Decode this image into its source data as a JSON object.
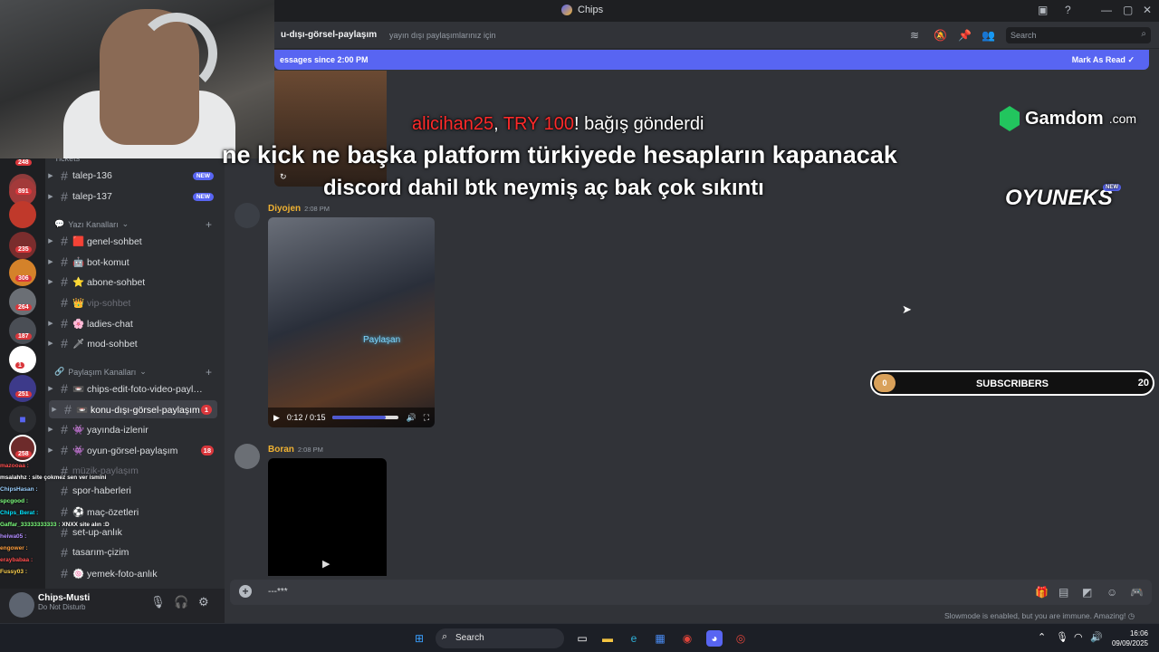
{
  "window": {
    "title": "Chips"
  },
  "header": {
    "channel_name": "konu-dışı-görsel-paylaşım",
    "channel_name_visible": "u-dışı-görsel-paylaşım",
    "topic": "yayın dışı paylaşımlarınız için",
    "search_placeholder": "Search"
  },
  "new_messages_bar": {
    "text": "essages since 2:00 PM",
    "mark_read": "Mark As Read"
  },
  "servers": [
    {
      "badge": "248"
    },
    {
      "badge": "891"
    },
    {
      "badge": ""
    },
    {
      "badge": "235"
    },
    {
      "badge": "306"
    },
    {
      "badge": "264"
    },
    {
      "badge": "187"
    },
    {
      "badge": "1"
    },
    {
      "badge": "251"
    },
    {
      "badge": ""
    },
    {
      "badge": "258"
    }
  ],
  "sidebar": {
    "categories": [
      {
        "label": "Tickets"
      },
      {
        "label": "Yazı Kanalları"
      },
      {
        "label": "Paylaşım Kanalları"
      }
    ],
    "channels": [
      {
        "label": "talep-136",
        "badge": "NEW"
      },
      {
        "label": "talep-137",
        "badge": "NEW"
      },
      {
        "label": "🟥 genel-sohbet"
      },
      {
        "label": "🤖 bot-komut"
      },
      {
        "label": "⭐ abone-sohbet"
      },
      {
        "label": "👑 vip-sohbet"
      },
      {
        "label": "🌸 ladies-chat"
      },
      {
        "label": "🗡 mod-sohbet"
      },
      {
        "label": "📼 chips-edit-foto-video-payla..."
      },
      {
        "label": "📼 konu-dışı-görsel-paylaşım",
        "badge": "1"
      },
      {
        "label": "👾 yayında-izlenir"
      },
      {
        "label": "👾 oyun-görsel-paylaşım",
        "badge": "18"
      },
      {
        "label": "müzik-paylaşım"
      },
      {
        "label": "spor-haberleri"
      },
      {
        "label": "⚽ maç-özetleri"
      },
      {
        "label": "set-up-anlık"
      },
      {
        "label": "tasarım-çizim"
      },
      {
        "label": "🍥 yemek-foto-anlık"
      }
    ]
  },
  "user": {
    "name": "Chips-Musti",
    "status": "Do Not Disturb"
  },
  "chat_overlay": [
    {
      "user": "mazooaa",
      "text": "",
      "color": "#ff4d4d"
    },
    {
      "user": "msalahhz",
      "text": "site çokmez sen ver ismini",
      "color": "#ffffff"
    },
    {
      "user": "ChipsHasan",
      "text": "",
      "color": "#9ad0ff"
    },
    {
      "user": "spcgood",
      "text": "",
      "color": "#7cff7c"
    },
    {
      "user": "Chips_Berat",
      "text": "",
      "color": "#00e5ff"
    },
    {
      "user": "Gaffar_33333333333",
      "text": "XNXX site alın :D",
      "color": "#7cff7c"
    },
    {
      "user": "heiwa05",
      "text": "",
      "color": "#b28cff"
    },
    {
      "user": "engower",
      "text": "",
      "color": "#ff9e3d"
    },
    {
      "user": "eraybabaa",
      "text": "",
      "color": "#ff4d4d"
    },
    {
      "user": "Fussy03",
      "text": "",
      "color": "#ffd24d"
    }
  ],
  "messages": [
    {
      "author": "Diyojen",
      "time": "2:08 PM",
      "video_time": "0:12 / 0:15",
      "progress": 0.8,
      "watermark": "Paylaşan"
    },
    {
      "author": "Boran",
      "time": "2:08 PM"
    }
  ],
  "overlays": {
    "donation_user": "alicihan25",
    "donation_sep": ", ",
    "donation_amount": "TRY 100",
    "donation_text": "! bağış gönderdi",
    "caption_line1": "ne kick ne başka platform türkiyede hesapların kapanacak",
    "caption_line2": "discord dahil btk neymiş aç bak çok sıkıntı",
    "sponsor1": "Gamdom",
    "sponsor1_tld": ".com",
    "sponsor2": "OYUNEKS",
    "sponsor2_badge": "NEW",
    "subs_count": "0",
    "subs_label": "SUBSCRIBERS",
    "subs_goal": "20"
  },
  "composer": {
    "text": "---***"
  },
  "slowmode": "Slowmode is enabled, but you are immune. Amazing!",
  "taskbar": {
    "search": "Search",
    "time": "16:06",
    "date": "09/09/2025"
  },
  "colors": {
    "accent": "#5865f2",
    "danger": "#da373c",
    "author": "#f0b232"
  }
}
